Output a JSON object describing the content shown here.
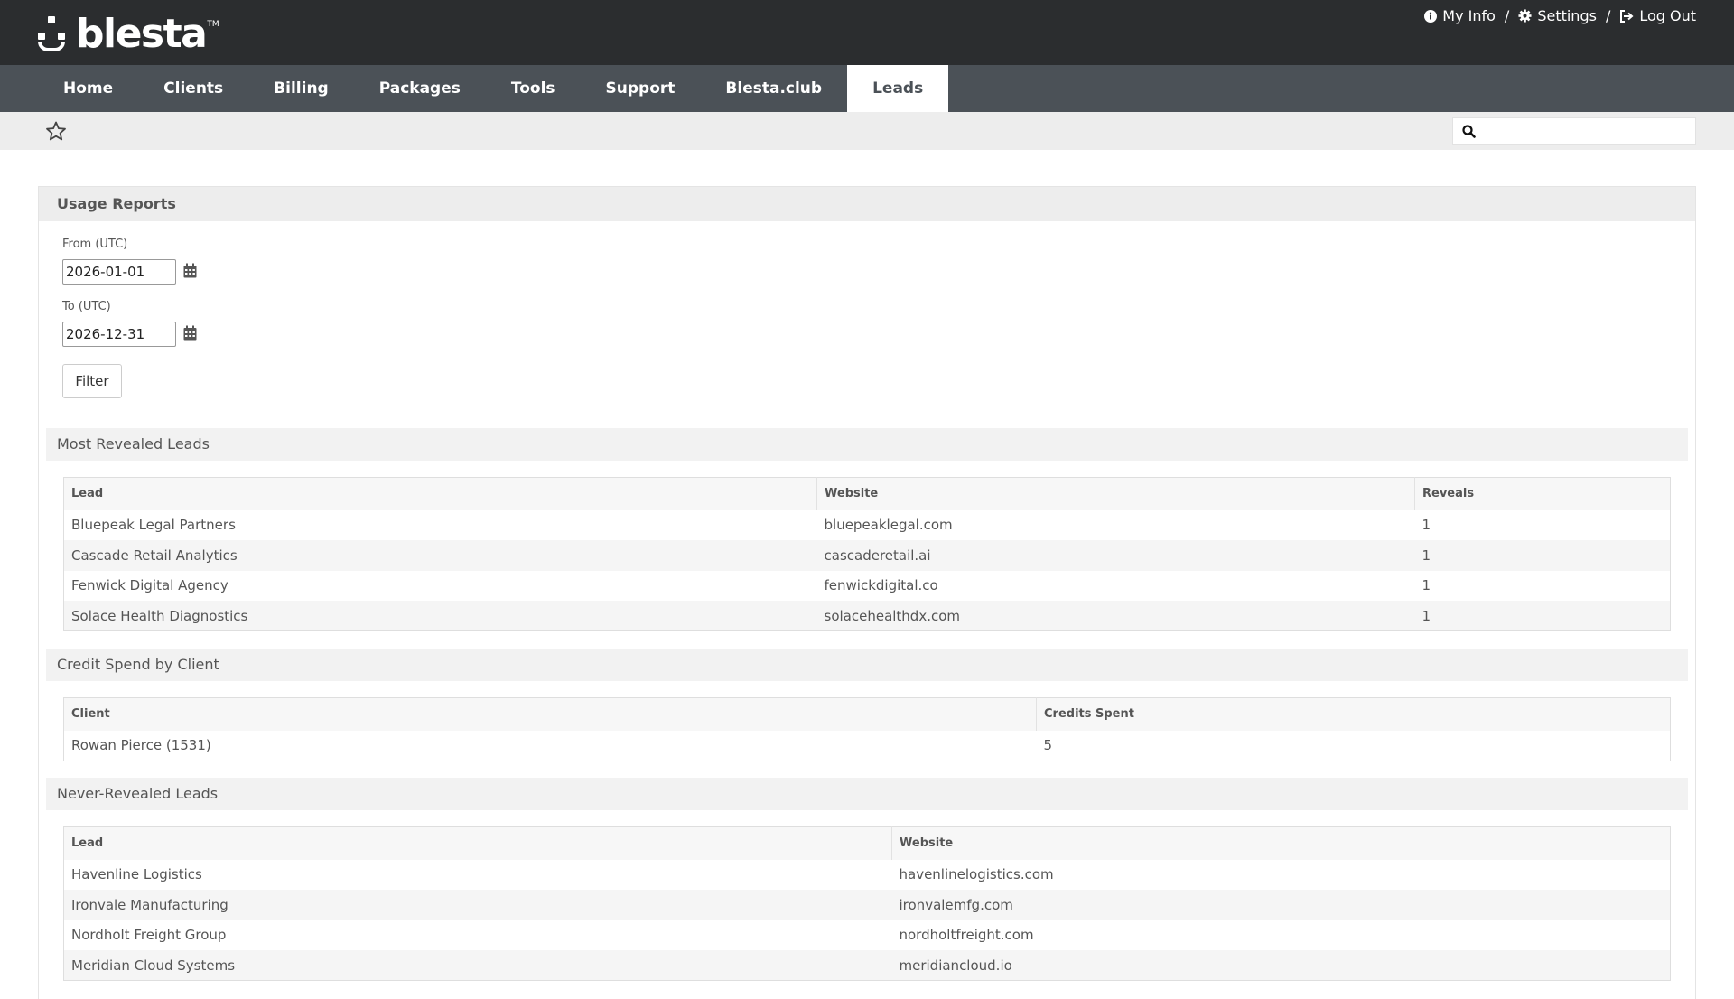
{
  "brand": {
    "name": "blesta",
    "tm": "TM"
  },
  "user_links": [
    {
      "label": "My Info",
      "icon": "info-circle-icon"
    },
    {
      "label": "Settings",
      "icon": "gear-icon"
    },
    {
      "label": "Log Out",
      "icon": "logout-icon"
    }
  ],
  "user_links_separator": "/",
  "nav": {
    "items": [
      "Home",
      "Clients",
      "Billing",
      "Packages",
      "Tools",
      "Support",
      "Blesta.club",
      "Leads"
    ],
    "active": "Leads"
  },
  "search": {
    "placeholder": "",
    "icon": "search-icon"
  },
  "page": {
    "title": "Usage Reports",
    "from_label": "From (UTC)",
    "from_value": "2026-01-01",
    "to_label": "To (UTC)",
    "to_value": "2026-12-31",
    "filter_label": "Filter"
  },
  "most_revealed": {
    "title": "Most Revealed Leads",
    "headers": [
      "Lead",
      "Website",
      "Reveals"
    ],
    "rows": [
      [
        "Bluepeak Legal Partners",
        "bluepeaklegal.com",
        "1"
      ],
      [
        "Cascade Retail Analytics",
        "cascaderetail.ai",
        "1"
      ],
      [
        "Fenwick Digital Agency",
        "fenwickdigital.co",
        "1"
      ],
      [
        "Solace Health Diagnostics",
        "solacehealthdx.com",
        "1"
      ]
    ]
  },
  "credit_spend": {
    "title": "Credit Spend by Client",
    "headers": [
      "Client",
      "Credits Spent"
    ],
    "rows": [
      [
        "Rowan Pierce (1531)",
        "5"
      ]
    ]
  },
  "never_revealed": {
    "title": "Never-Revealed Leads",
    "headers": [
      "Lead",
      "Website"
    ],
    "rows": [
      [
        "Havenline Logistics",
        "havenlinelogistics.com"
      ],
      [
        "Ironvale Manufacturing",
        "ironvalemfg.com"
      ],
      [
        "Nordholt Freight Group",
        "nordholtfreight.com"
      ],
      [
        "Meridian Cloud Systems",
        "meridiancloud.io"
      ]
    ]
  }
}
